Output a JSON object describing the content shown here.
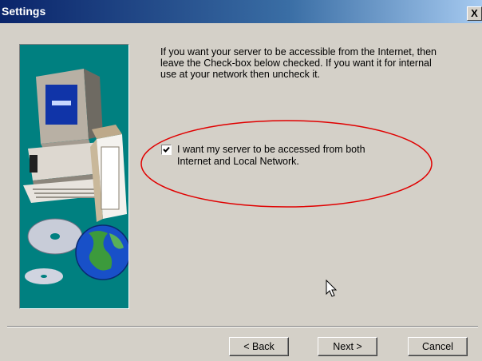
{
  "window": {
    "title": "Settings",
    "close_label": "X"
  },
  "content": {
    "description": "If you want your server to be accessible from the Internet, then\nleave the Check-box below checked. If you want it for internal\nuse at your network then uncheck it.",
    "checkbox": {
      "checked": true,
      "label": "I want my server to be accessed from both\nInternet and Local Network."
    },
    "highlight_color": "#e00000"
  },
  "buttons": {
    "back": "< Back",
    "next": "Next >",
    "cancel": "Cancel"
  },
  "colors": {
    "window_bg": "#d4d0c8",
    "panel_bg": "#008080",
    "title_start": "#0a246a",
    "title_end": "#a6caf0"
  }
}
